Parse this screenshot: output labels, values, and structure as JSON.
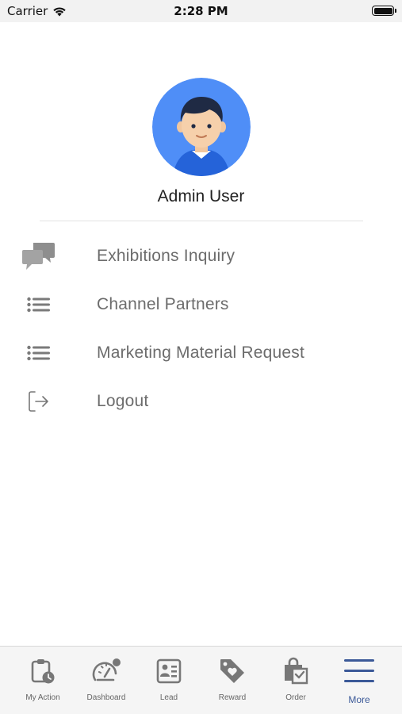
{
  "status_bar": {
    "carrier": "Carrier",
    "time": "2:28 PM"
  },
  "profile": {
    "name": "Admin User"
  },
  "menu": [
    {
      "label": "Exhibitions Inquiry",
      "icon": "chat-bubbles-icon"
    },
    {
      "label": "Channel Partners",
      "icon": "list-icon"
    },
    {
      "label": "Marketing Material Request",
      "icon": "list-icon"
    },
    {
      "label": "Logout",
      "icon": "logout-icon"
    }
  ],
  "tab_bar": {
    "active_color": "#3b5998",
    "tabs": [
      {
        "label": "My Action",
        "icon": "clipboard-clock-icon"
      },
      {
        "label": "Dashboard",
        "icon": "speedometer-icon"
      },
      {
        "label": "Lead",
        "icon": "contact-card-icon"
      },
      {
        "label": "Reward",
        "icon": "tag-heart-icon"
      },
      {
        "label": "Order",
        "icon": "shopping-bag-icon"
      },
      {
        "label": "More",
        "icon": "hamburger-menu-icon",
        "active": true
      }
    ]
  }
}
